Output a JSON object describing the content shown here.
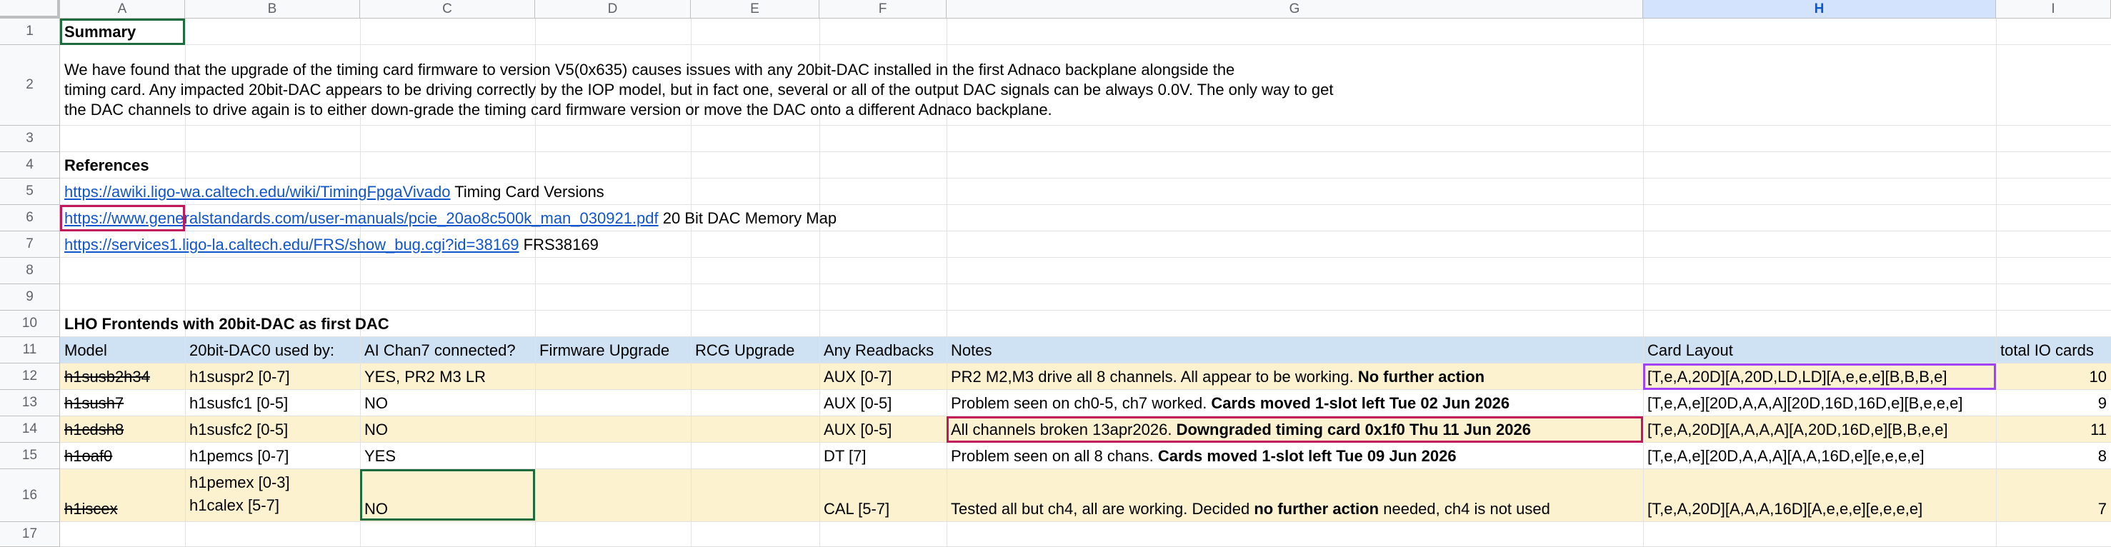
{
  "columns": [
    "A",
    "B",
    "C",
    "D",
    "E",
    "F",
    "G",
    "H",
    "I"
  ],
  "selected_column": "H",
  "rows": [
    "1",
    "2",
    "3",
    "4",
    "5",
    "6",
    "7",
    "8",
    "9",
    "10",
    "11",
    "12",
    "13",
    "14",
    "15",
    "16",
    "17"
  ],
  "summary_title": "Summary",
  "summary_lines": [
    "We have found that the upgrade of the timing card firmware to version V5(0x635) causes issues with any 20bit-DAC installed in the first Adnaco backplane alongside the",
    "timing card. Any impacted 20bit-DAC appears to be driving correctly by the IOP model, but in fact one, several or all of the output DAC signals can be always 0.0V. The only way to get",
    "the DAC channels to drive again is to either down-grade the timing card firmware version or move the DAC onto a different Adnaco backplane."
  ],
  "references_title": "References",
  "references": [
    {
      "url": "https://awiki.ligo-wa.caltech.edu/wiki/TimingFpgaVivado",
      "label": "Timing Card Versions"
    },
    {
      "url": "https://www.generalstandards.com/user-manuals/pcie_20ao8c500k_man_030921.pdf",
      "label": "20 Bit DAC Memory Map"
    },
    {
      "url": "https://services1.ligo-la.caltech.edu/FRS/show_bug.cgi?id=38169",
      "label": "FRS38169"
    }
  ],
  "table_title": "LHO Frontends with 20bit-DAC as first DAC",
  "table_headers": [
    "Model",
    "20bit-DAC0 used by:",
    "AI Chan7 connected?",
    "Firmware Upgrade",
    "RCG Upgrade",
    "Any Readbacks",
    "Notes",
    "Card Layout",
    "total IO cards"
  ],
  "table_rows": [
    {
      "model": "h1susb2h34",
      "dac_used_1": "h1suspr2 [0-7]",
      "dac_used_2": "",
      "ai_chan7": "YES, PR2 M3 LR",
      "firmware": "",
      "rcg": "",
      "readbacks": "AUX [0-7]",
      "notes_a": "PR2 M2,M3 drive all 8 channels. All appear to be working. ",
      "notes_b": "No further action",
      "notes_c": "",
      "notes_d": "",
      "layout": "[T,e,A,20D][A,20D,LD,LD][A,e,e,e][B,B,B,e]",
      "total": "10"
    },
    {
      "model": "h1sush7",
      "dac_used_1": "h1susfc1 [0-5]",
      "dac_used_2": "",
      "ai_chan7": "NO",
      "firmware": "",
      "rcg": "",
      "readbacks": "AUX [0-5]",
      "notes_a": "Problem seen on ch0-5, ch7 worked. ",
      "notes_b": "Cards moved 1-slot left Tue 02 Jun 2026",
      "notes_c": "",
      "notes_d": "",
      "layout": "[T,e,A,e][20D,A,A,A][20D,16D,16D,e][B,e,e,e]",
      "total": "9"
    },
    {
      "model": "h1cdsh8",
      "dac_used_1": "h1susfc2 [0-5]",
      "dac_used_2": "",
      "ai_chan7": "NO",
      "firmware": "",
      "rcg": "",
      "readbacks": "AUX [0-5]",
      "notes_a": "All channels broken 13apr2026. ",
      "notes_b": "Downgraded timing card 0x1f0 Thu 11 Jun 2026",
      "notes_c": "",
      "notes_d": "",
      "layout": "[T,e,A,20D][A,A,A,A][A,20D,16D,e][B,B,e,e]",
      "total": "11"
    },
    {
      "model": "h1oaf0",
      "dac_used_1": "h1pemcs [0-7]",
      "dac_used_2": "",
      "ai_chan7": "YES",
      "firmware": "",
      "rcg": "",
      "readbacks": "DT [7]",
      "notes_a": "Problem seen on all 8 chans. ",
      "notes_b": "Cards moved 1-slot left Tue 09 Jun 2026",
      "notes_c": "",
      "notes_d": "",
      "layout": "[T,e,A,e][20D,A,A,A][A,A,16D,e][e,e,e,e]",
      "total": "8"
    },
    {
      "model": "h1iscex",
      "dac_used_1": "h1pemex [0-3]",
      "dac_used_2": "h1calex [5-7]",
      "ai_chan7": "NO",
      "firmware": "",
      "rcg": "",
      "readbacks": "CAL [5-7]",
      "notes_a": "Tested all but ch4, all are working. Decided ",
      "notes_b": "no further action",
      "notes_c": " needed, ch4 is not used",
      "notes_d": "",
      "layout": "[T,e,A,20D][A,A,A,16D][A,e,e,e][e,e,e,e]",
      "total": "7"
    }
  ]
}
